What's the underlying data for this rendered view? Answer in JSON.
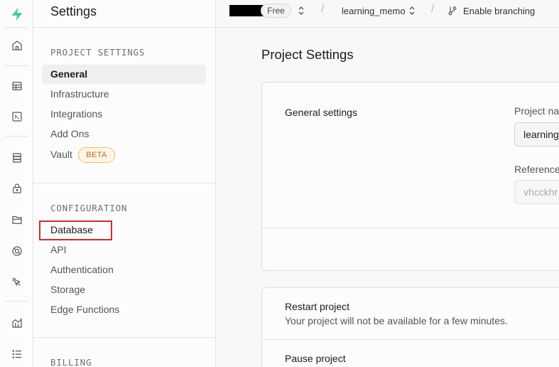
{
  "rail": {
    "icons": [
      "supabase-logo-icon",
      "home-icon",
      "table-editor-icon",
      "sql-editor-icon",
      "database-icon",
      "auth-lock-icon",
      "storage-icon",
      "realtime-icon",
      "edge-functions-icon",
      "reports-icon",
      "logs-icon"
    ],
    "brand_color": "#3ecf8e"
  },
  "menu": {
    "title": "Settings",
    "sections": [
      {
        "heading": "PROJECT SETTINGS",
        "items": [
          "General",
          "Infrastructure",
          "Integrations",
          "Add Ons",
          "Vault"
        ]
      },
      {
        "heading": "CONFIGURATION",
        "items": [
          "Database",
          "API",
          "Authentication",
          "Storage",
          "Edge Functions"
        ]
      },
      {
        "heading": "BILLING",
        "items": []
      }
    ],
    "active_item": "General",
    "vault_badge": "BETA",
    "highlight_color": "#d9272e"
  },
  "topbar": {
    "plan": "Free",
    "separator": "/",
    "project": "learning_memo",
    "branching": "Enable branching"
  },
  "main": {
    "title": "Project Settings",
    "general": {
      "section_label": "General settings",
      "project_name_label": "Project na",
      "project_name_value": "learning",
      "reference_label": "Reference",
      "reference_value": "vhcckhr"
    },
    "restart": {
      "title": "Restart project",
      "description": "Your project will not be available for a few minutes."
    },
    "pause": {
      "title": "Pause project"
    }
  }
}
